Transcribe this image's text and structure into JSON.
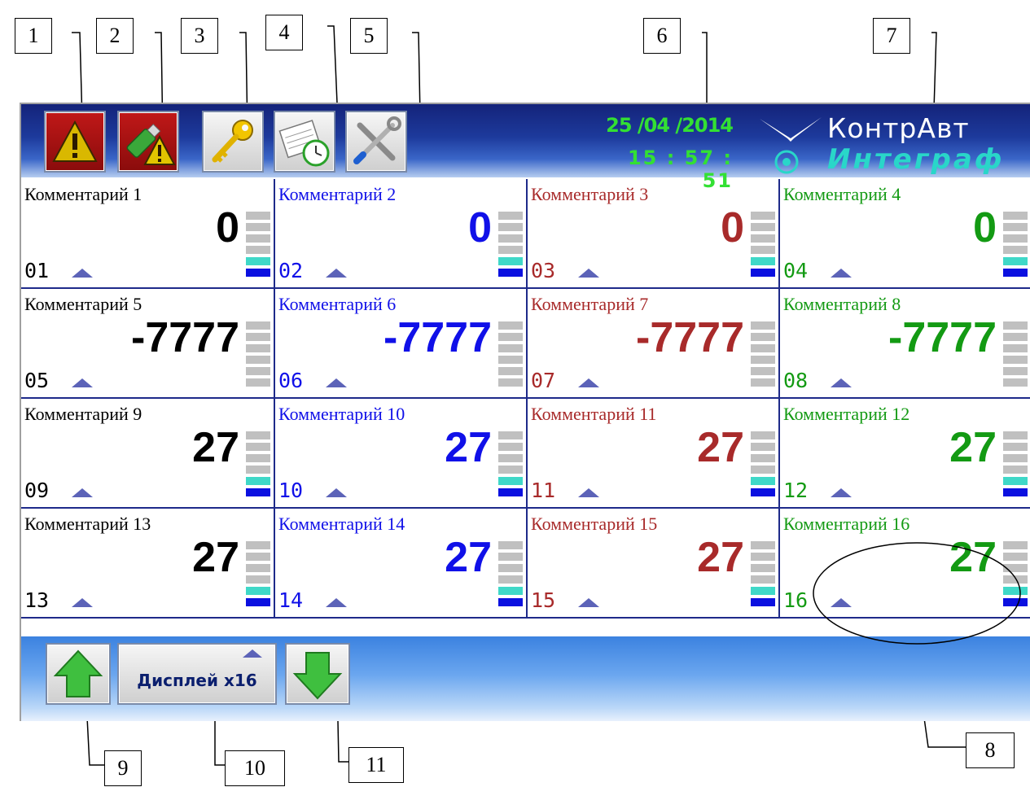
{
  "callouts": [
    "1",
    "2",
    "3",
    "4",
    "5",
    "6",
    "7",
    "8",
    "9",
    "10",
    "11"
  ],
  "header": {
    "date": "25 /04 /2014",
    "time": "15 : 57 : 51",
    "brand_primary": "КонтрАвт",
    "brand_secondary": "Интеграф",
    "buttons": [
      {
        "name": "alarm-button",
        "icon": "warning-icon"
      },
      {
        "name": "usb-alarm-button",
        "icon": "usb-warning-icon"
      },
      {
        "name": "access-key-button",
        "icon": "key-icon"
      },
      {
        "name": "schedule-button",
        "icon": "notepad-clock-icon"
      },
      {
        "name": "settings-button",
        "icon": "tools-icon"
      }
    ]
  },
  "colors": {
    "black": "#000000",
    "blue": "#1010e8",
    "red": "#a82a2a",
    "green": "#139a13",
    "time_green": "#33e033",
    "bar_grey": "#c0c0c0",
    "bar_cyan": "#3fd8c8",
    "bar_blue": "#0b10e0"
  },
  "channels": [
    {
      "comment": "Комментарий 1",
      "value": "0",
      "number": "01",
      "color": "black",
      "bar_level": 2
    },
    {
      "comment": "Комментарий 2",
      "value": "0",
      "number": "02",
      "color": "blue",
      "bar_level": 2
    },
    {
      "comment": "Комментарий 3",
      "value": "0",
      "number": "03",
      "color": "red",
      "bar_level": 2
    },
    {
      "comment": "Комментарий 4",
      "value": "0",
      "number": "04",
      "color": "green",
      "bar_level": 2
    },
    {
      "comment": "Комментарий 5",
      "value": "-7777",
      "number": "05",
      "color": "black",
      "bar_level": 0
    },
    {
      "comment": "Комментарий 6",
      "value": "-7777",
      "number": "06",
      "color": "blue",
      "bar_level": 0
    },
    {
      "comment": "Комментарий 7",
      "value": "-7777",
      "number": "07",
      "color": "red",
      "bar_level": 0
    },
    {
      "comment": "Комментарий 8",
      "value": "-7777",
      "number": "08",
      "color": "green",
      "bar_level": 0
    },
    {
      "comment": "Комментарий 9",
      "value": "27",
      "number": "09",
      "color": "black",
      "bar_level": 2
    },
    {
      "comment": "Комментарий 10",
      "value": "27",
      "number": "10",
      "color": "blue",
      "bar_level": 2
    },
    {
      "comment": "Комментарий 11",
      "value": "27",
      "number": "11",
      "color": "red",
      "bar_level": 2
    },
    {
      "comment": "Комментарий 12",
      "value": "27",
      "number": "12",
      "color": "green",
      "bar_level": 2
    },
    {
      "comment": "Комментарий 13",
      "value": "27",
      "number": "13",
      "color": "black",
      "bar_level": 2
    },
    {
      "comment": "Комментарий 14",
      "value": "27",
      "number": "14",
      "color": "blue",
      "bar_level": 2
    },
    {
      "comment": "Комментарий 15",
      "value": "27",
      "number": "15",
      "color": "red",
      "bar_level": 2
    },
    {
      "comment": "Комментарий 16",
      "value": "27",
      "number": "16",
      "color": "green",
      "bar_level": 2
    }
  ],
  "footer": {
    "display_label": "Дисплей x16",
    "page_up_icon": "green-arrow-up-icon",
    "page_down_icon": "green-arrow-down-icon"
  }
}
